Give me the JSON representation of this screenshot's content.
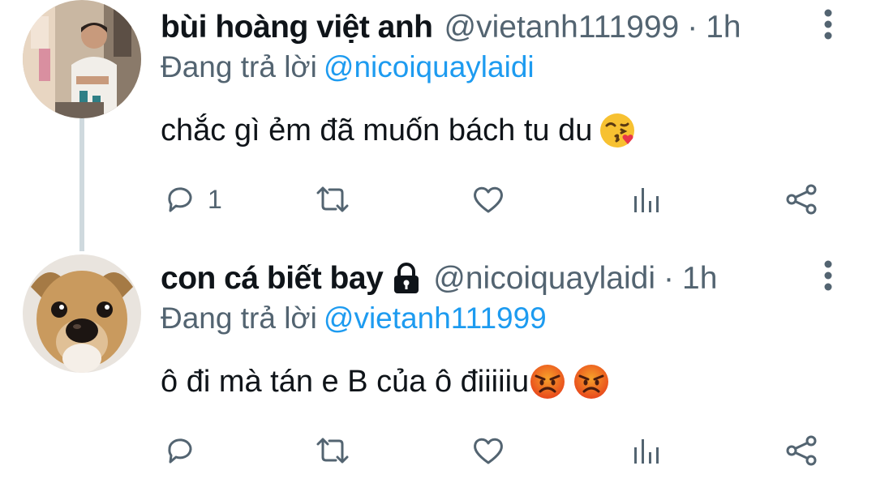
{
  "tweets": [
    {
      "name": "bùi hoàng việt anh",
      "handle": "@vietanh111999",
      "separator": "·",
      "time": "1h",
      "reply_prefix": "Đang trả lời",
      "reply_mention": "@nicoiquaylaidi",
      "text": "chắc gì ẻm đã muốn bách tu du",
      "emojis": [
        "face-blowing-kiss-emoji"
      ],
      "reply_count": "1",
      "locked": false
    },
    {
      "name": "con cá biết bay",
      "handle": "@nicoiquaylaidi",
      "separator": "·",
      "time": "1h",
      "reply_prefix": "Đang trả lời",
      "reply_mention": "@vietanh111999",
      "text": "ô đi mà tán e B của ô điiiiiu",
      "emojis": [
        "angry-face-emoji",
        "angry-face-emoji"
      ],
      "reply_count": "",
      "locked": true
    }
  ],
  "colors": {
    "text": "#0f1419",
    "secondary": "#536471",
    "link": "#1d9bf0",
    "thread_line": "#cfd9de"
  }
}
